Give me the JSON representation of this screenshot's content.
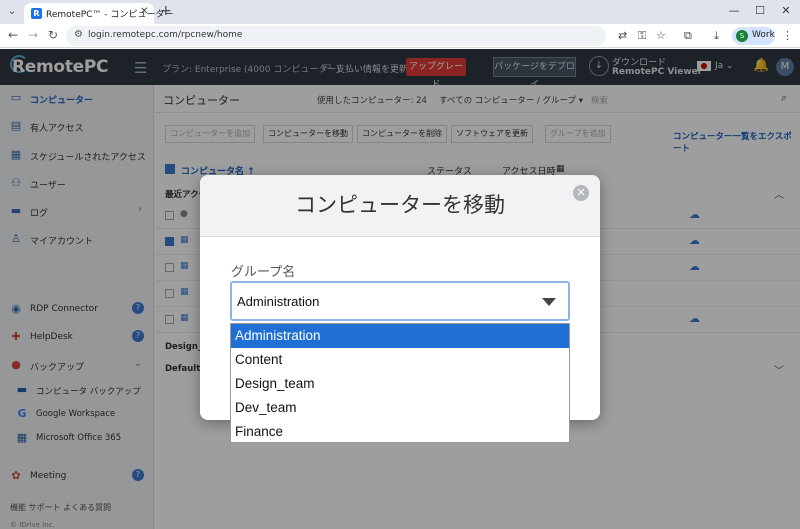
{
  "browser": {
    "tab_title": "RemotePC™ - コンピューター",
    "url": "login.remotepc.com/rpcnew/home",
    "profile_label": "Work",
    "profile_initial": "S"
  },
  "header": {
    "logo": "RemotePC",
    "plan": "プラン: Enterprise (4000 コンピューター)",
    "payment_update": "支払い情報を更新",
    "upgrade": "アップグレード",
    "deploy_package": "パッケージをデプロイ",
    "download_line1": "ダウンロード",
    "download_line2": "RemotePC Viewer",
    "language": "Ja",
    "avatar_initial": "M"
  },
  "sidebar": {
    "items": [
      {
        "label": "コンピューター"
      },
      {
        "label": "有人アクセス"
      },
      {
        "label": "スケジュールされたアクセス"
      },
      {
        "label": "ユーザー"
      },
      {
        "label": "ログ"
      },
      {
        "label": "マイアカウント"
      },
      {
        "label": "RDP Connector"
      },
      {
        "label": "HelpDesk"
      },
      {
        "label": "バックアップ"
      },
      {
        "label": "コンピュータ バックアップ"
      },
      {
        "label": "Google Workspace"
      },
      {
        "label": "Microsoft Office 365"
      },
      {
        "label": "Meeting"
      }
    ],
    "footer": "機能    サポート    よくある質問",
    "copyright": "© IDrive Inc."
  },
  "main": {
    "title": "コンピューター",
    "used_computers": "使用したコンピューター: 24",
    "group_filter": "すべての コンピューター / グループ",
    "search_placeholder": "検索",
    "toolbar": {
      "add_computer": "コンピューターを追加",
      "move_computer": "コンピューターを移動",
      "delete_computer": "コンピューターを削除",
      "update_software": "ソフトウェアを更新",
      "add_group": "グループを追加",
      "export_list": "コンピューター一覧をエクスポート"
    },
    "table": {
      "col_name": "コンピュータ名 ↑",
      "col_status": "ステータス",
      "col_access": "アクセス日時",
      "recent_group": "最近アクセス",
      "group_design": "Design_te",
      "group_default": "Default"
    }
  },
  "modal": {
    "title": "コンピューターを移動",
    "field_label": "グループ名",
    "selected_value": "Administration",
    "options": [
      "Administration",
      "Content",
      "Design_team",
      "Dev_team",
      "Finance"
    ]
  }
}
